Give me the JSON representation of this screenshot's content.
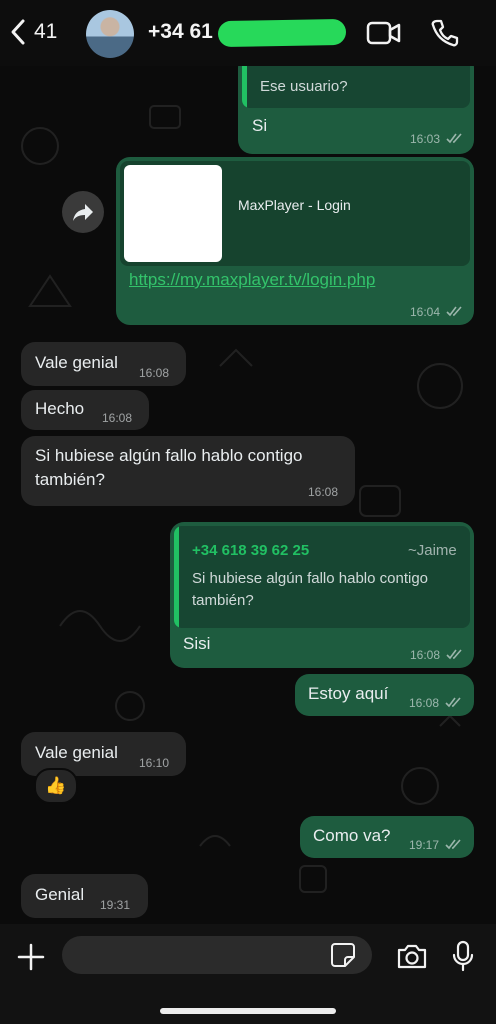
{
  "header": {
    "back_count": "41",
    "contact_name": "+34 61",
    "icons": {
      "back": "chevron-left-icon",
      "video": "video-call-icon",
      "phone": "phone-icon"
    }
  },
  "messages": [
    {
      "id": "m1",
      "side": "out",
      "quote_text": "Ese usuario?",
      "text": "Si",
      "time": "16:03",
      "status": "read"
    },
    {
      "id": "m2",
      "side": "out",
      "link_title": "MaxPlayer - Login",
      "link_url": "https://my.maxplayer.tv/login.php",
      "time": "16:04",
      "status": "read"
    },
    {
      "id": "m3",
      "side": "in",
      "text": "Vale genial",
      "time": "16:08"
    },
    {
      "id": "m4",
      "side": "in",
      "text": "Hecho",
      "time": "16:08"
    },
    {
      "id": "m5",
      "side": "in",
      "text": "Si hubiese algún fallo hablo contigo también?",
      "time": "16:08"
    },
    {
      "id": "m6",
      "side": "out",
      "quote_name": "+34 618 39 62 25",
      "quote_author": "~Jaime",
      "quote_text": "Si hubiese algún fallo hablo contigo también?",
      "text": "Sisi",
      "time": "16:08",
      "status": "read"
    },
    {
      "id": "m7",
      "side": "out",
      "text": "Estoy aquí",
      "time": "16:08",
      "status": "read"
    },
    {
      "id": "m8",
      "side": "in",
      "text": "Vale genial",
      "time": "16:10",
      "reaction": "👍"
    },
    {
      "id": "m9",
      "side": "out",
      "text": "Como va?",
      "time": "19:17",
      "status": "read"
    },
    {
      "id": "m10",
      "side": "in",
      "text": "Genial",
      "time": "19:31"
    }
  ],
  "composer": {
    "placeholder": ""
  },
  "colors": {
    "outgoing": "#1e5c3f",
    "incoming": "#262626",
    "accent": "#21c063",
    "link": "#33c36b"
  }
}
